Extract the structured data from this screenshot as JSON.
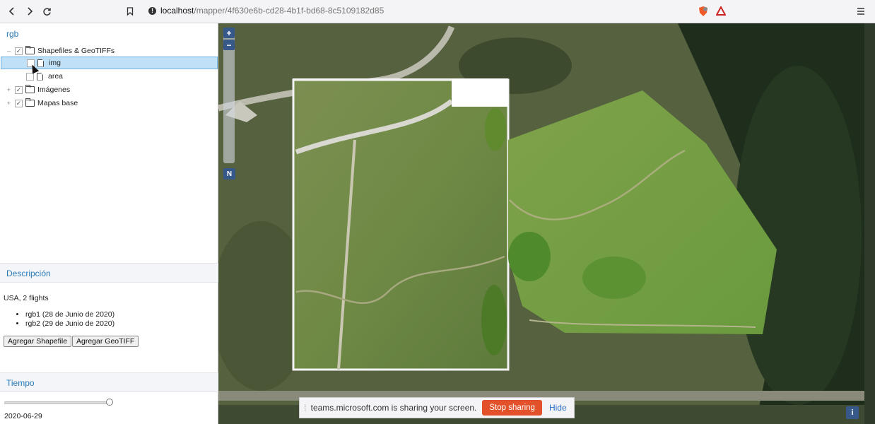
{
  "browser": {
    "url_host": "localhost",
    "url_path": "/mapper/4f630e6b-cd28-4b1f-bd68-8c5109182d85"
  },
  "panel": {
    "project_title": "rgb",
    "tree": [
      {
        "label": "Shapefiles & GeoTIFFs",
        "type": "folder",
        "checked": true,
        "expander": "–"
      },
      {
        "label": "img",
        "type": "file",
        "checked": false,
        "selected": true
      },
      {
        "label": "area",
        "type": "file",
        "checked": false
      },
      {
        "label": "Imágenes",
        "type": "folder",
        "checked": true,
        "expander": "+"
      },
      {
        "label": "Mapas base",
        "type": "folder",
        "checked": true,
        "expander": "+"
      }
    ],
    "description_header": "Descripción",
    "description_text": "USA, 2 flights",
    "description_items": [
      "rgb1 (28 de Junio de 2020)",
      "rgb2 (29 de Junio de 2020)"
    ],
    "add_shapefile_label": "Agregar Shapefile",
    "add_geotiff_label": "Agregar GeoTIFF",
    "time_header": "Tiempo",
    "time_value": "2020-06-29",
    "time_slider_fraction": 0.97
  },
  "map": {
    "zoom_in_label": "+",
    "zoom_out_label": "−",
    "north_label": "N",
    "info_label": "i"
  },
  "share_bar": {
    "message": "teams.microsoft.com is sharing your screen.",
    "stop_label": "Stop sharing",
    "hide_label": "Hide"
  }
}
